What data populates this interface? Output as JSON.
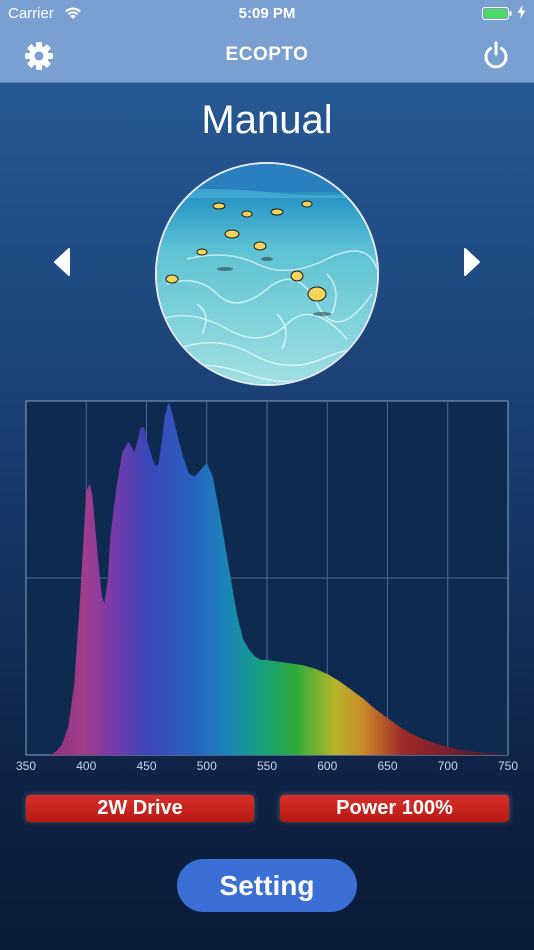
{
  "status_bar": {
    "carrier": "Carrier",
    "time": "5:09 PM",
    "battery_color": "#4cd964"
  },
  "nav": {
    "title": "ECOPTO",
    "left_icon": "gear-icon",
    "right_icon": "power-icon"
  },
  "mode": {
    "title": "Manual",
    "prev_icon": "chevron-left-icon",
    "next_icon": "chevron-right-icon"
  },
  "chart_data": {
    "type": "area",
    "title": "",
    "xlabel": "",
    "ylabel": "",
    "xlim": [
      350,
      750
    ],
    "ylim": [
      0,
      1
    ],
    "x_ticks": [
      350,
      400,
      450,
      500,
      550,
      600,
      650,
      700,
      750
    ],
    "grid": true,
    "series": [
      {
        "x": [
          360,
          370,
          375,
          380,
          385,
          390,
          395,
          400,
          403,
          405,
          410,
          413,
          415,
          418,
          420,
          425,
          430,
          435,
          437,
          440,
          443,
          445,
          448,
          450,
          455,
          458,
          460,
          463,
          465,
          468,
          470,
          475,
          480,
          485,
          490,
          495,
          500,
          505,
          510,
          515,
          520,
          525,
          530,
          535,
          540,
          545,
          550,
          560,
          570,
          580,
          590,
          600,
          610,
          620,
          630,
          640,
          650,
          660,
          670,
          680,
          690,
          700,
          710,
          720,
          730,
          740,
          750
        ],
        "values": [
          0,
          0,
          0.01,
          0.03,
          0.08,
          0.2,
          0.45,
          0.75,
          0.77,
          0.74,
          0.55,
          0.45,
          0.43,
          0.5,
          0.62,
          0.76,
          0.86,
          0.89,
          0.88,
          0.86,
          0.9,
          0.93,
          0.93,
          0.9,
          0.84,
          0.82,
          0.83,
          0.9,
          0.96,
          1.0,
          0.99,
          0.92,
          0.85,
          0.8,
          0.79,
          0.81,
          0.83,
          0.79,
          0.7,
          0.6,
          0.5,
          0.4,
          0.33,
          0.3,
          0.28,
          0.27,
          0.27,
          0.265,
          0.26,
          0.255,
          0.245,
          0.23,
          0.21,
          0.185,
          0.16,
          0.13,
          0.105,
          0.08,
          0.06,
          0.045,
          0.033,
          0.023,
          0.015,
          0.01,
          0.006,
          0.003,
          0.001
        ]
      }
    ]
  },
  "badges": {
    "drive": "2W Drive",
    "power": "Power 100%"
  },
  "setting_button": "Setting"
}
